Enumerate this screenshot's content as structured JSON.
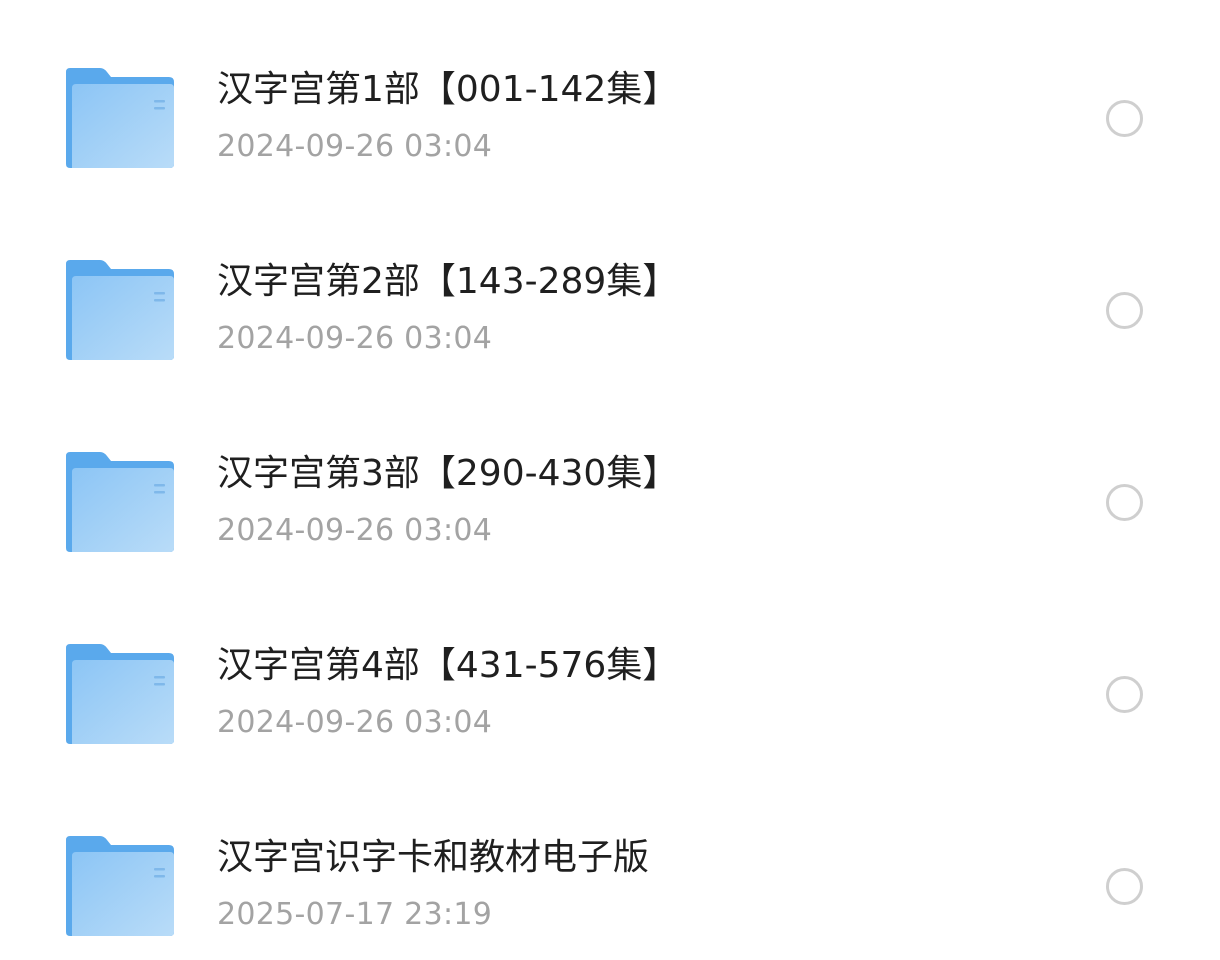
{
  "folders": [
    {
      "name": "汉字宫第1部【001-142集】",
      "date": "2024-09-26 03:04",
      "icon": "folder-icon",
      "selected": false
    },
    {
      "name": "汉字宫第2部【143-289集】",
      "date": "2024-09-26 03:04",
      "icon": "folder-icon",
      "selected": false
    },
    {
      "name": "汉字宫第3部【290-430集】",
      "date": "2024-09-26 03:04",
      "icon": "folder-icon",
      "selected": false
    },
    {
      "name": "汉字宫第4部【431-576集】",
      "date": "2024-09-26 03:04",
      "icon": "folder-icon",
      "selected": false
    },
    {
      "name": "汉字宫识字卡和教材电子版",
      "date": "2025-07-17 23:19",
      "icon": "folder-icon",
      "selected": false
    }
  ],
  "colors": {
    "folder_light": "#b9dcf8",
    "folder_dark": "#5aa9ec",
    "title_text": "#1f1f1f",
    "date_text": "#a3a3a3",
    "checkbox_border": "#cfcfcf"
  }
}
